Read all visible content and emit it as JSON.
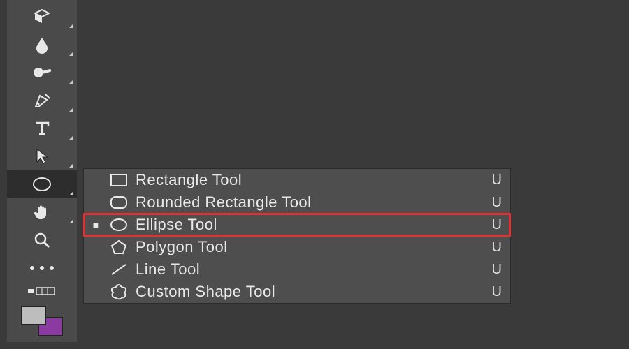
{
  "toolbar": {
    "tools": [
      {
        "id": "gradient-tool"
      },
      {
        "id": "blur-tool"
      },
      {
        "id": "dodge-tool"
      },
      {
        "id": "pen-tool"
      },
      {
        "id": "type-tool"
      },
      {
        "id": "path-selection-tool"
      },
      {
        "id": "shape-tool",
        "selected": true
      },
      {
        "id": "hand-tool"
      },
      {
        "id": "zoom-tool"
      },
      {
        "id": "more-options"
      }
    ],
    "swatch": {
      "foreground": "#bdbdbd",
      "background": "#8a3aa0"
    }
  },
  "flyout": {
    "items": [
      {
        "id": "rectangle-tool",
        "label": "Rectangle Tool",
        "shortcut": "U",
        "active": false
      },
      {
        "id": "rounded-rectangle-tool",
        "label": "Rounded Rectangle Tool",
        "shortcut": "U",
        "active": false
      },
      {
        "id": "ellipse-tool",
        "label": "Ellipse Tool",
        "shortcut": "U",
        "active": true
      },
      {
        "id": "polygon-tool",
        "label": "Polygon Tool",
        "shortcut": "U",
        "active": false
      },
      {
        "id": "line-tool",
        "label": "Line Tool",
        "shortcut": "U",
        "active": false
      },
      {
        "id": "custom-shape-tool",
        "label": "Custom Shape Tool",
        "shortcut": "U",
        "active": false
      }
    ]
  }
}
